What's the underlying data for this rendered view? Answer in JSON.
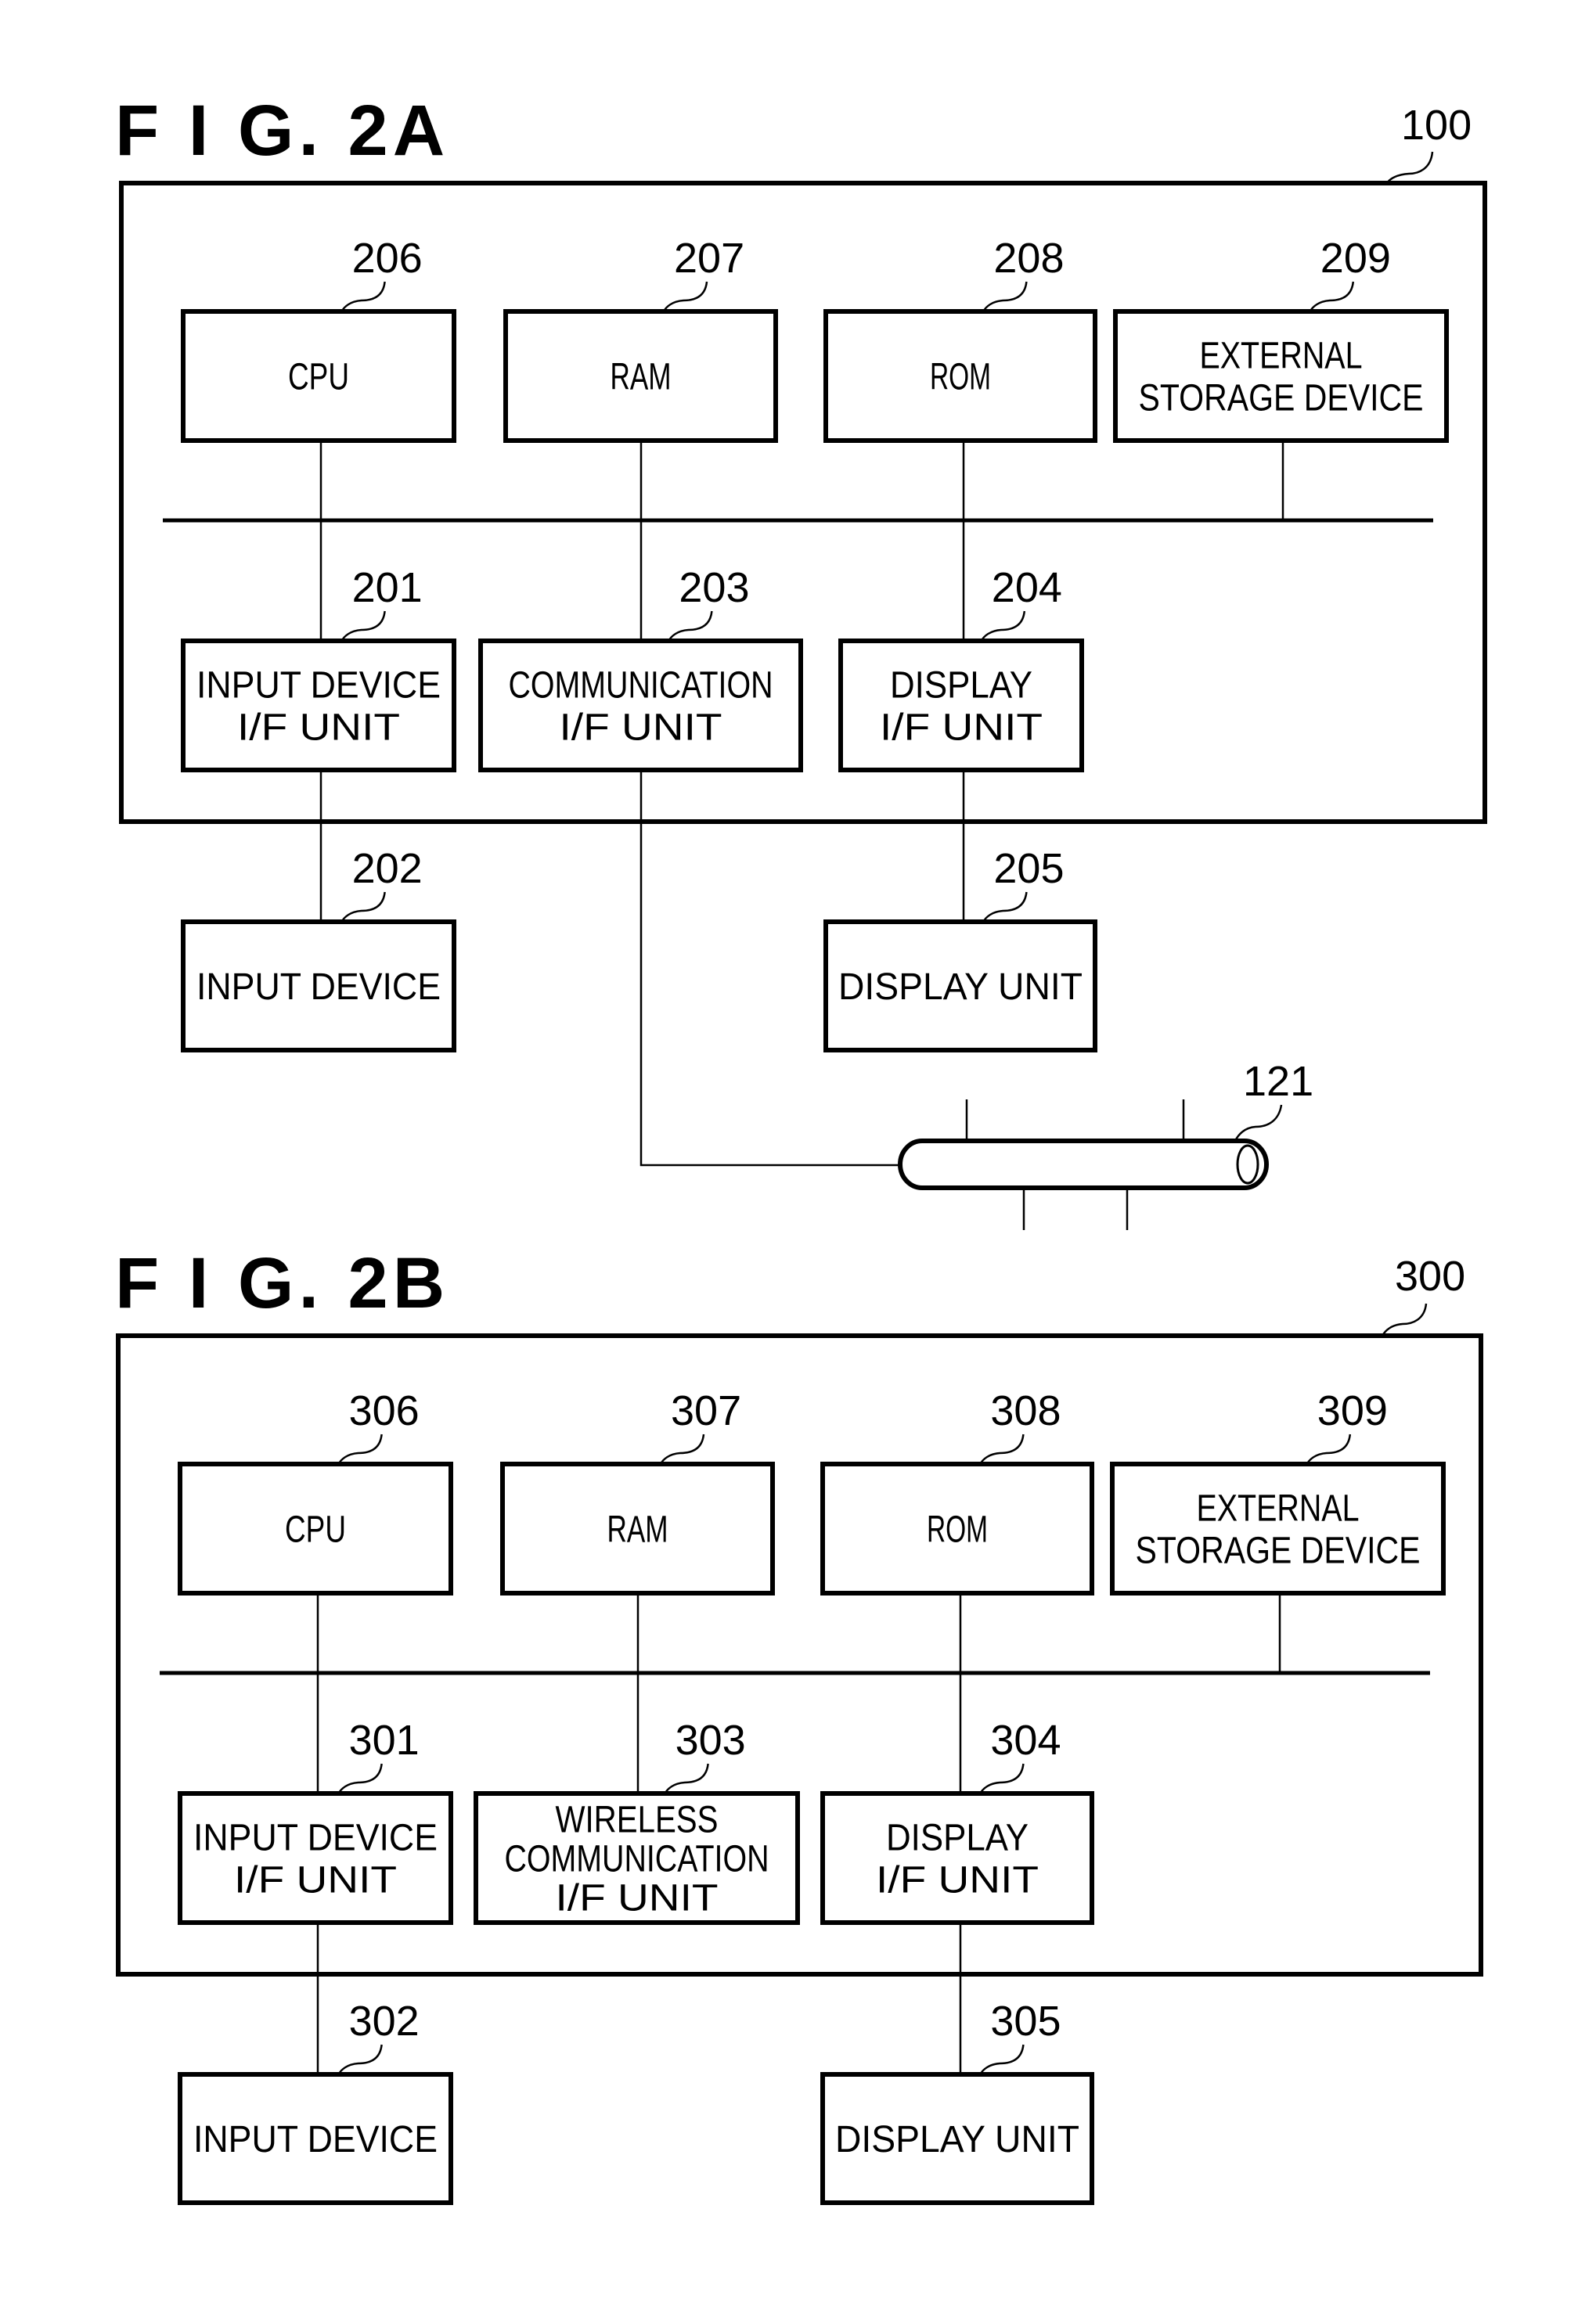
{
  "fig_2a": {
    "title": "F I G.  2A",
    "ref": "100",
    "components": {
      "cpu": {
        "ref": "206",
        "lines": [
          "CPU"
        ]
      },
      "ram": {
        "ref": "207",
        "lines": [
          "RAM"
        ]
      },
      "rom": {
        "ref": "208",
        "lines": [
          "ROM"
        ]
      },
      "ext": {
        "ref": "209",
        "lines": [
          "EXTERNAL",
          "STORAGE DEVICE"
        ]
      },
      "input_if": {
        "ref": "201",
        "lines": [
          "INPUT DEVICE",
          "I/F UNIT"
        ]
      },
      "comm_if": {
        "ref": "203",
        "lines": [
          "COMMUNICATION",
          "I/F UNIT"
        ]
      },
      "display_if": {
        "ref": "204",
        "lines": [
          "DISPLAY",
          "I/F UNIT"
        ]
      },
      "input_device": {
        "ref": "202",
        "lines": [
          "INPUT DEVICE"
        ]
      },
      "display_unit": {
        "ref": "205",
        "lines": [
          "DISPLAY UNIT"
        ]
      }
    },
    "network_ref": "121"
  },
  "fig_2b": {
    "title": "F I G.  2B",
    "ref": "300",
    "components": {
      "cpu": {
        "ref": "306",
        "lines": [
          "CPU"
        ]
      },
      "ram": {
        "ref": "307",
        "lines": [
          "RAM"
        ]
      },
      "rom": {
        "ref": "308",
        "lines": [
          "ROM"
        ]
      },
      "ext": {
        "ref": "309",
        "lines": [
          "EXTERNAL",
          "STORAGE DEVICE"
        ]
      },
      "input_if": {
        "ref": "301",
        "lines": [
          "INPUT DEVICE",
          "I/F UNIT"
        ]
      },
      "comm_if": {
        "ref": "303",
        "lines": [
          "WIRELESS",
          "COMMUNICATION",
          "I/F UNIT"
        ]
      },
      "display_if": {
        "ref": "304",
        "lines": [
          "DISPLAY",
          "I/F UNIT"
        ]
      },
      "input_device": {
        "ref": "302",
        "lines": [
          "INPUT DEVICE"
        ]
      },
      "display_unit": {
        "ref": "305",
        "lines": [
          "DISPLAY UNIT"
        ]
      }
    }
  }
}
